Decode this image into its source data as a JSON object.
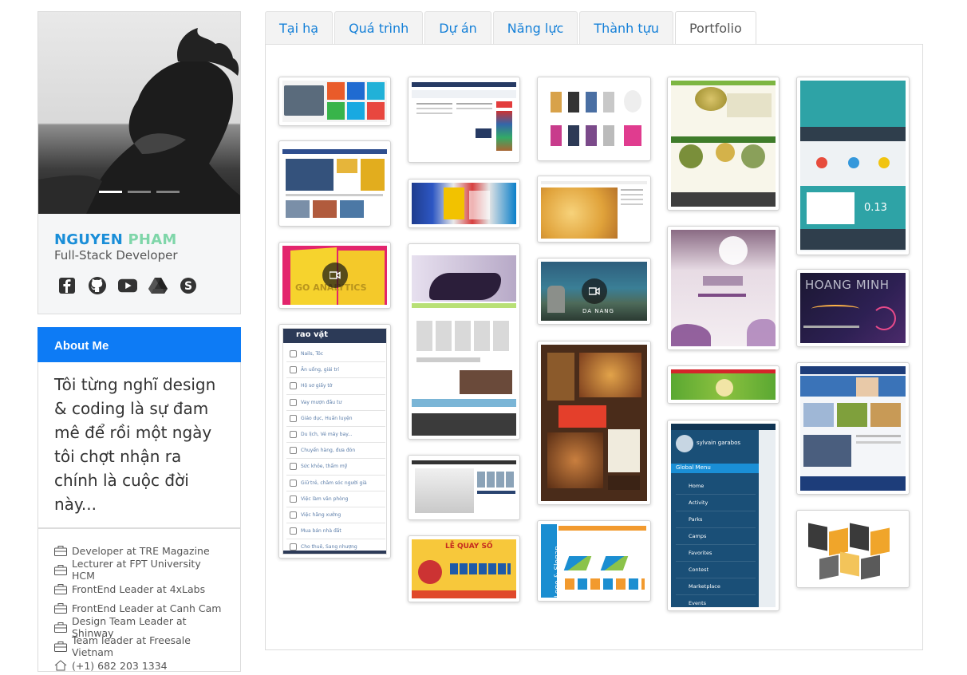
{
  "profile": {
    "first_name": "NGUYEN",
    "last_name": "PHAM",
    "role": "Full-Stack Developer",
    "social_icons": [
      "facebook-icon",
      "github-icon",
      "youtube-icon",
      "google-drive-icon",
      "skype-icon"
    ]
  },
  "about": {
    "header": "About Me",
    "text": "Tôi từng nghĩ design & coding là sự đam mê để rồi một ngày tôi chợt nhận ra chính là cuộc đời này...",
    "experience": [
      "Developer at TRE Magazine",
      "Lecturer at FPT University HCM",
      "FrontEnd Leader at 4xLabs",
      "FrontEnd Leader at Canh Cam",
      "Design Team Leader at Shinway",
      "Team leader at Freesale Vietnam"
    ],
    "phone": "(+1) 682 203 1334"
  },
  "tabs": [
    "Tại hạ",
    "Quá trình",
    "Dự án",
    "Năng lực",
    "Thành tựu",
    "Portfolio"
  ],
  "active_tab": "Portfolio",
  "portfolio": {
    "thumb_texts": {
      "analytics": "GO ANALYTICS",
      "danang": "DA NANG",
      "raovat": "rao vặt",
      "hoangminh": "HOANG MINH",
      "rate": "0.13",
      "logo_slogan": "Logo & Slogan",
      "quayso": "LỄ QUAY SỐ",
      "mobile_user": "sylvain garabos",
      "mobile_menu_title": "Global Menu",
      "mobile_menu": [
        "Home",
        "Activity",
        "Parks",
        "Camps",
        "Favorites",
        "Contest",
        "Marketplace",
        "Events"
      ],
      "raovat_menu": [
        "Nails, Tóc",
        "Ăn uống, giải trí",
        "Hộ sơ giấy tờ",
        "Vay mượn đầu tư",
        "Giáo dục, Huấn luyện",
        "Du lịch, Vé máy bay...",
        "Chuyển hàng, đưa đón",
        "Sức khỏe, thẩm mỹ",
        "Giữ trẻ, chăm sóc người già",
        "Việc làm văn phòng",
        "Việc hãng xưởng",
        "Mua bán nhà đất",
        "Cho thuê, Sang nhượng"
      ]
    }
  },
  "colors": {
    "primary": "#0d7bf5",
    "tab_link": "#1580d8",
    "name_first": "#1a8ed8",
    "name_last": "#7fd6a9"
  }
}
